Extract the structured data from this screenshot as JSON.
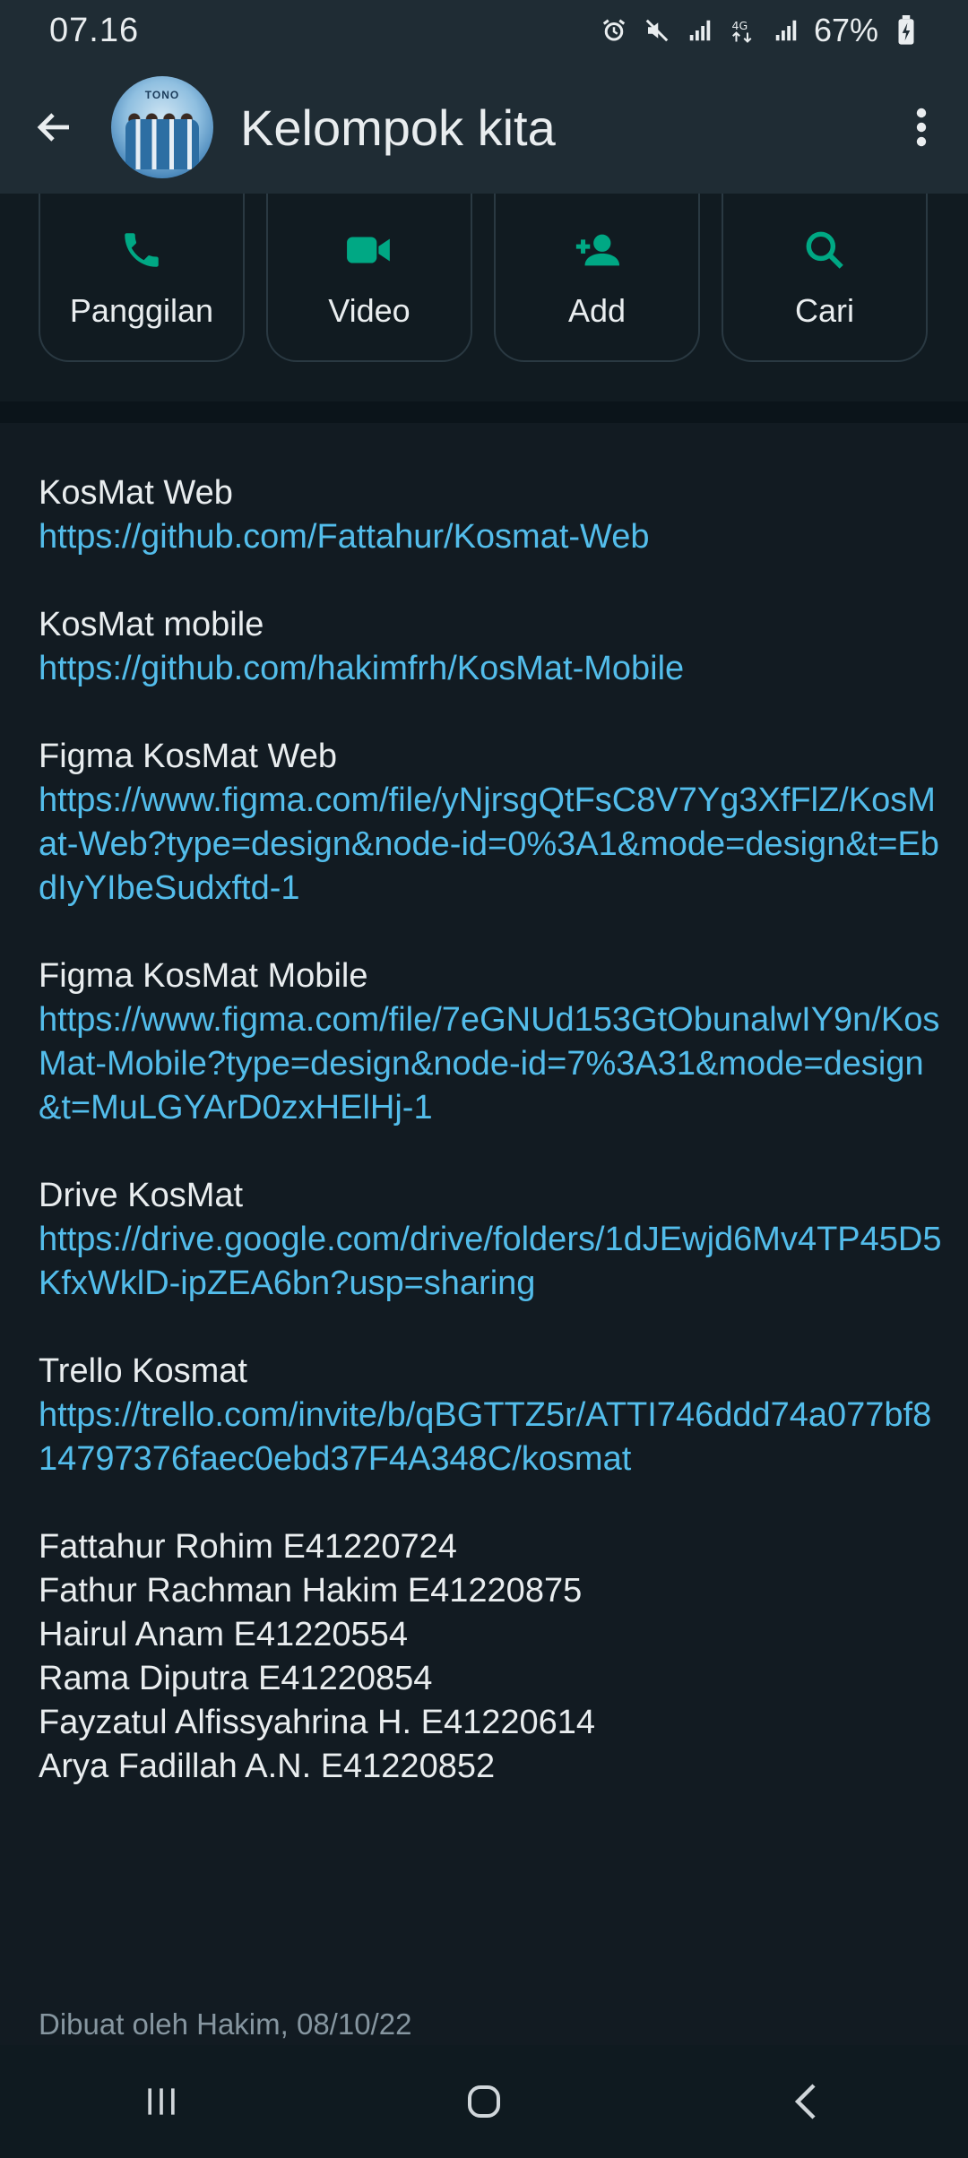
{
  "status_bar": {
    "time": "07.16",
    "battery": "67%",
    "icons": [
      "alarm-icon",
      "mute-icon",
      "signal-icon",
      "4g-data-icon",
      "signal-icon",
      "battery-charging-icon"
    ]
  },
  "header": {
    "title": "Kelompok kita",
    "avatar_text": "TONO"
  },
  "actions": [
    {
      "label": "Panggilan",
      "icon": "phone-icon"
    },
    {
      "label": "Video",
      "icon": "video-icon"
    },
    {
      "label": "Add",
      "icon": "add-person-icon"
    },
    {
      "label": "Cari",
      "icon": "search-icon"
    }
  ],
  "description": {
    "links": [
      {
        "label": "KosMat Web",
        "url": "https://github.com/Fattahur/Kosmat-Web"
      },
      {
        "label": "KosMat mobile",
        "url": "https://github.com/hakimfrh/KosMat-Mobile"
      },
      {
        "label": "Figma KosMat Web",
        "url": "https://www.figma.com/file/yNjrsgQtFsC8V7Yg3XfFlZ/KosMat-Web?type=design&node-id=0%3A1&mode=design&t=EbdIyYIbeSudxftd-1"
      },
      {
        "label": "Figma KosMat Mobile",
        "url": "https://www.figma.com/file/7eGNUd153GtObunalwIY9n/KosMat-Mobile?type=design&node-id=7%3A31&mode=design&t=MuLGYArD0zxHElHj-1"
      },
      {
        "label": "Drive KosMat",
        "url": "https://drive.google.com/drive/folders/1dJEwjd6Mv4TP45D5KfxWklD-ipZEA6bn?usp=sharing"
      },
      {
        "label": "Trello Kosmat",
        "url": "https://trello.com/invite/b/qBGTTZ5r/ATTI746ddd74a077bf814797376faec0ebd37F4A348C/kosmat"
      }
    ],
    "members": [
      "Fattahur Rohim E41220724",
      "Fathur Rachman Hakim E41220875",
      "Hairul Anam E41220554",
      "Rama Diputra E41220854",
      "Fayzatul Alfissyahrina H. E41220614",
      "Arya Fadillah A.N. E41220852"
    ]
  },
  "created_by": "Dibuat oleh Hakim, 08/10/22",
  "colors": {
    "accent": "#00a884",
    "link": "#53bdeb",
    "background": "#121b22",
    "header": "#1f2c34"
  }
}
